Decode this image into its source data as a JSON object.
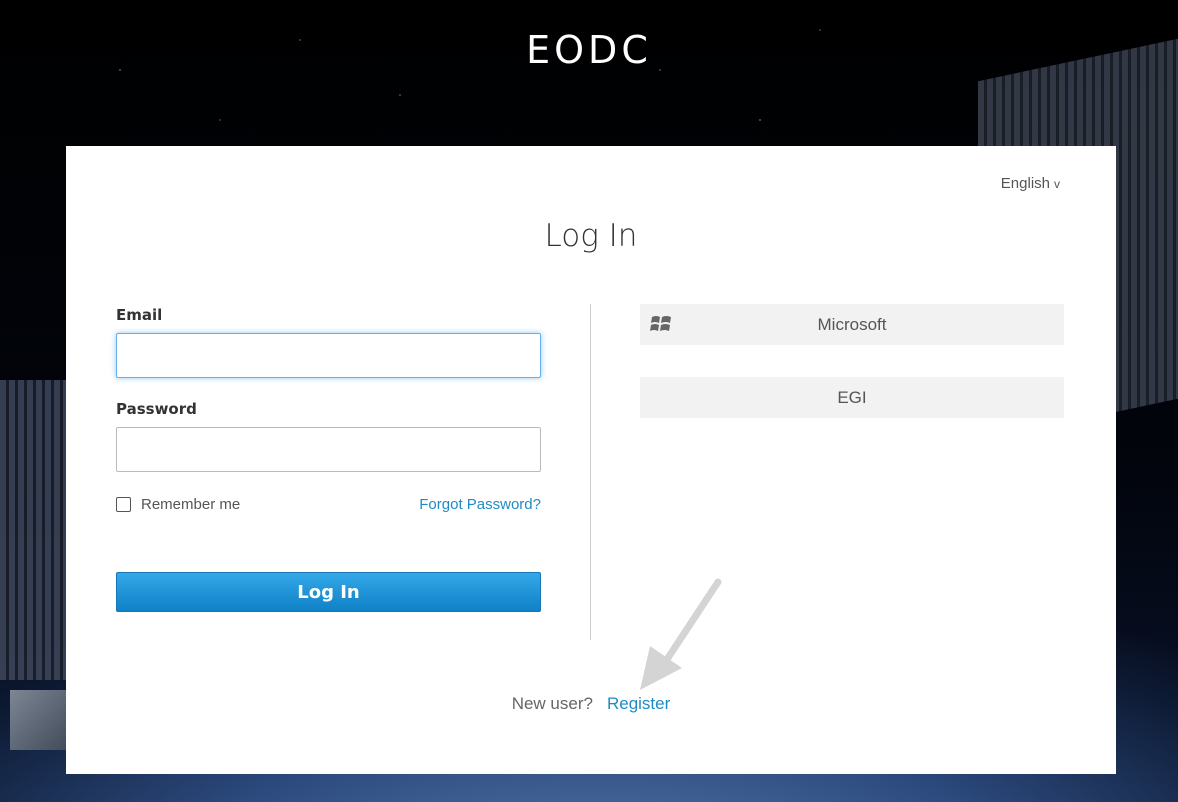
{
  "brand": {
    "name": "EODC"
  },
  "language": {
    "selected": "English",
    "chevron": "v"
  },
  "login": {
    "title": "Log In",
    "email_label": "Email",
    "email_value": "",
    "password_label": "Password",
    "password_value": "",
    "remember_label": "Remember me",
    "remember_checked": false,
    "forgot_label": "Forgot Password?",
    "submit_label": "Log In"
  },
  "providers": [
    {
      "label": "Microsoft",
      "icon": "windows-icon"
    },
    {
      "label": "EGI",
      "icon": ""
    }
  ],
  "register": {
    "prompt": "New user?",
    "link_label": "Register"
  },
  "colors": {
    "accent": "#1f8bc6",
    "button_top": "#34a8e8",
    "button_bottom": "#0f82c8",
    "provider_bg": "#f2f2f2"
  }
}
